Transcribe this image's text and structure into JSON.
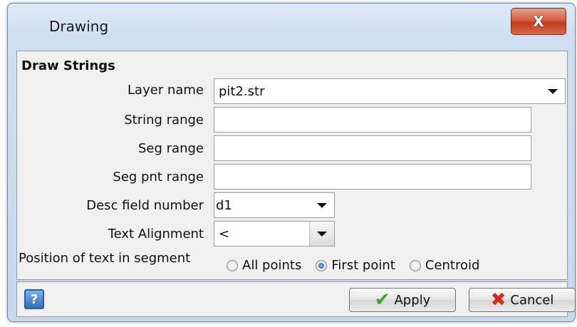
{
  "window": {
    "title": "Drawing",
    "close_label": "X"
  },
  "section": {
    "header": "Draw Strings"
  },
  "fields": {
    "layer_name": {
      "label": "Layer name",
      "value": "pit2.str"
    },
    "string_range": {
      "label": "String range",
      "value": ""
    },
    "seg_range": {
      "label": "Seg range",
      "value": ""
    },
    "seg_pnt_range": {
      "label": "Seg pnt range",
      "value": ""
    },
    "desc_field_number": {
      "label": "Desc field number",
      "value": "d1"
    },
    "text_alignment": {
      "label": "Text Alignment",
      "value": "<"
    }
  },
  "position": {
    "label": "Position of text in segment",
    "options": [
      "All points",
      "First point",
      "Centroid"
    ],
    "selected": "First point"
  },
  "buttons": {
    "help": "?",
    "apply": "Apply",
    "cancel": "Cancel"
  },
  "icons": {
    "close": "close-icon",
    "help": "help-icon",
    "apply": "check-icon",
    "cancel": "cross-icon"
  }
}
